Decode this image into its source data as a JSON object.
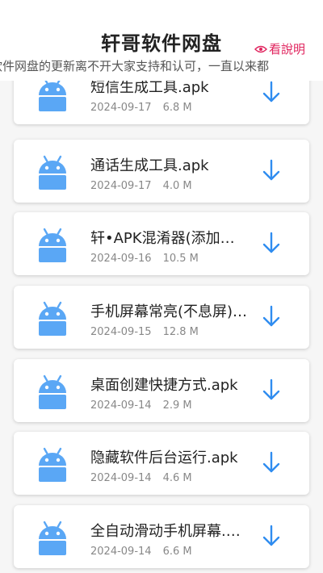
{
  "header": {
    "title": "轩哥软件网盘",
    "help_label": "看說明",
    "marquee": "软件网盘的更新离不开大家支持和认可，一直以来都"
  },
  "colors": {
    "accent": "#2f8cf0",
    "icon": "#5aa7f5",
    "help": "#e0245e"
  },
  "files": [
    {
      "name": "短信生成工具.apk",
      "date": "2024-09-17",
      "size": "6.8 M",
      "icon": "android-icon"
    },
    {
      "name": "通话生成工具.apk",
      "date": "2024-09-17",
      "size": "4.0 M",
      "icon": "android-icon"
    },
    {
      "name": "轩•APK混淆器(添加花指令).apk",
      "date": "2024-09-16",
      "size": "10.5 M",
      "icon": "android-icon"
    },
    {
      "name": "手机屏幕常亮(不息屏).apk",
      "date": "2024-09-15",
      "size": "12.8 M",
      "icon": "android-icon"
    },
    {
      "name": "桌面创建快捷方式.apk",
      "date": "2024-09-14",
      "size": "2.9 M",
      "icon": "android-icon"
    },
    {
      "name": "隐藏软件后台运行.apk",
      "date": "2024-09-14",
      "size": "4.6 M",
      "icon": "android-icon"
    },
    {
      "name": "全自动滑动手机屏幕.apk",
      "date": "2024-09-14",
      "size": "6.6 M",
      "icon": "android-icon"
    }
  ]
}
